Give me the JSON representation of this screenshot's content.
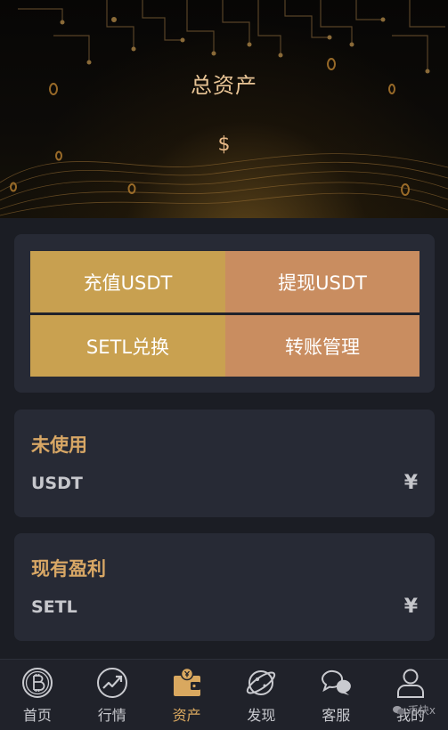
{
  "header": {
    "title": "总资产",
    "amount": "$"
  },
  "actions": {
    "deposit_label": "充值USDT",
    "withdraw_label": "提现USDT",
    "exchange_label": "SETL兑换",
    "transfer_label": "转账管理"
  },
  "balances": [
    {
      "title": "未使用",
      "coin": "USDT",
      "value": "¥"
    },
    {
      "title": "现有盈利",
      "coin": "SETL",
      "value": "¥"
    }
  ],
  "nav": {
    "items": [
      {
        "label": "首页",
        "icon": "bitcoin-icon"
      },
      {
        "label": "行情",
        "icon": "trend-chart-icon"
      },
      {
        "label": "资产",
        "icon": "wallet-icon",
        "active": true
      },
      {
        "label": "发现",
        "icon": "planet-icon"
      },
      {
        "label": "客服",
        "icon": "chat-bubbles-icon"
      },
      {
        "label": "我的",
        "icon": "user-icon"
      }
    ]
  },
  "watermark": "币快x",
  "colors": {
    "accent_gold": "#c8a050",
    "accent_copper": "#c98d60",
    "title_gold": "#d8a765",
    "background": "#1b1d24",
    "card": "#272a35"
  }
}
